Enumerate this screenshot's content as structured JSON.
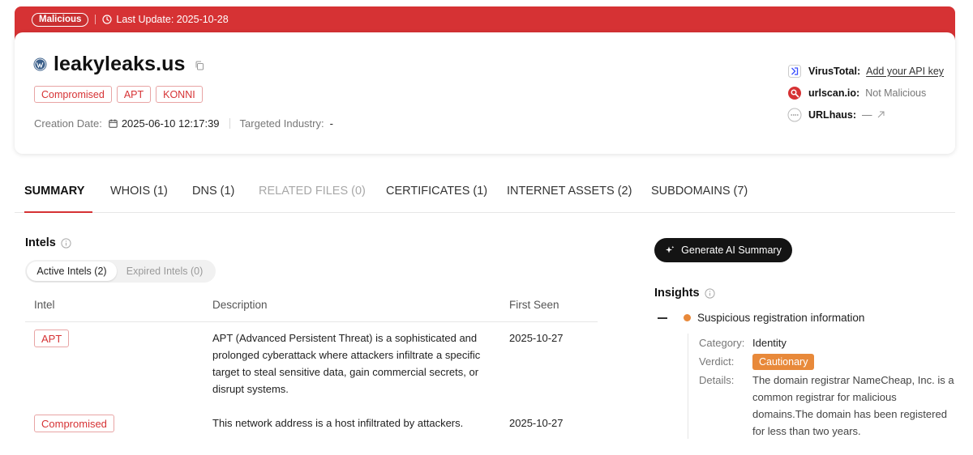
{
  "banner": {
    "status_label": "Malicious",
    "last_update": "Last Update: 2025-10-28"
  },
  "header": {
    "domain": "leakyleaks.us",
    "tags": [
      "Compromised",
      "APT",
      "KONNI"
    ],
    "creation_date_label": "Creation Date:",
    "creation_date_value": "2025-06-10 12:17:39",
    "industry_label": "Targeted Industry:",
    "industry_value": "-",
    "checks": [
      {
        "label": "VirusTotal:",
        "value": "Add your API key",
        "icon": "virustotal-icon"
      },
      {
        "label": "urlscan.io:",
        "value": "Not Malicious",
        "icon": "urlscan-icon"
      },
      {
        "label": "URLhaus:",
        "value": "—",
        "icon": "urlhaus-icon"
      }
    ]
  },
  "tabs": [
    {
      "label": "SUMMARY",
      "state": "active"
    },
    {
      "label": "WHOIS (1)",
      "state": "normal"
    },
    {
      "label": "DNS (1)",
      "state": "normal"
    },
    {
      "label": "RELATED FILES (0)",
      "state": "disabled"
    },
    {
      "label": "CERTIFICATES (1)",
      "state": "normal"
    },
    {
      "label": "INTERNET ASSETS (2)",
      "state": "normal"
    },
    {
      "label": "SUBDOMAINS (7)",
      "state": "normal"
    }
  ],
  "intels": {
    "title": "Intels",
    "segments": {
      "active": "Active Intels (2)",
      "expired": "Expired Intels (0)"
    },
    "columns": [
      "Intel",
      "Description",
      "First Seen"
    ],
    "rows": [
      {
        "intel": "APT",
        "description": "APT (Advanced Persistent Threat) is a sophisticated and prolonged cyberattack where attackers infiltrate a specific target to steal sensitive data, gain commercial secrets, or disrupt systems.",
        "first_seen": "2025-10-27"
      },
      {
        "intel": "Compromised",
        "description": "This network address is a host infiltrated by attackers.",
        "first_seen": "2025-10-27"
      }
    ]
  },
  "ai_button": {
    "label": "Generate AI Summary"
  },
  "insights": {
    "title": "Insights",
    "item_title": "Suspicious registration information",
    "category_label": "Category:",
    "category_value": "Identity",
    "verdict_label": "Verdict:",
    "verdict_value": "Cautionary",
    "details_label": "Details:",
    "details_value": "The domain registrar NameCheap, Inc. is a common registrar for malicious domains.The domain has been registered for less than two years."
  },
  "colors": {
    "brand_red": "#d63234",
    "cautionary_orange": "#e8893a",
    "dark_button": "#141414"
  }
}
